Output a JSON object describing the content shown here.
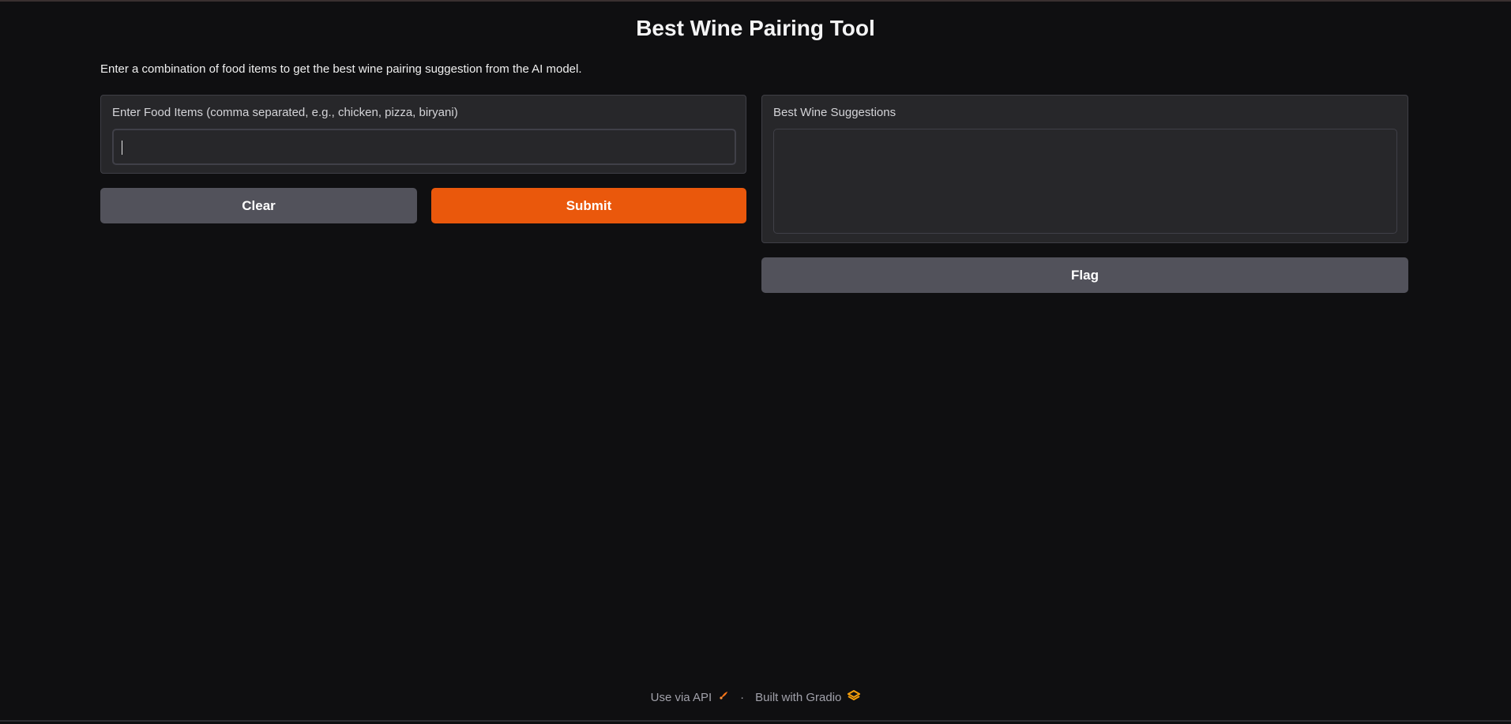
{
  "title": "Best Wine Pairing Tool",
  "description": "Enter a combination of food items to get the best wine pairing suggestion from the AI model.",
  "input": {
    "label": "Enter Food Items (comma separated, e.g., chicken, pizza, biryani)",
    "value": "",
    "placeholder": ""
  },
  "output": {
    "label": "Best Wine Suggestions",
    "value": ""
  },
  "buttons": {
    "clear": "Clear",
    "submit": "Submit",
    "flag": "Flag"
  },
  "footer": {
    "api": "Use via API",
    "separator": "·",
    "built": "Built with Gradio",
    "api_icon": "rocket-icon",
    "gradio_icon": "gradio-logo-icon"
  },
  "colors": {
    "accent": "#ea580c",
    "background": "#0f0f11",
    "panel": "#27272a",
    "secondary_button": "#52525b"
  }
}
